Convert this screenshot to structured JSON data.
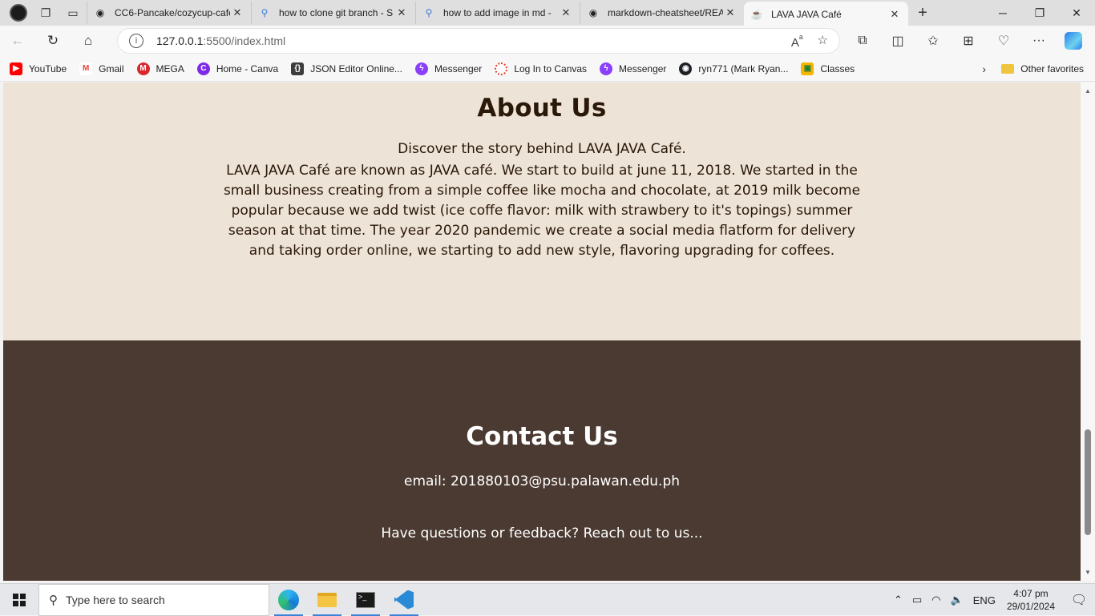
{
  "browser": {
    "tabs": [
      {
        "title": "CC6-Pancake/cozycup-cafe",
        "icon": "github-icon"
      },
      {
        "title": "how to clone git branch - S",
        "icon": "search-icon"
      },
      {
        "title": "how to add image in md -",
        "icon": "search-icon"
      },
      {
        "title": "markdown-cheatsheet/REA",
        "icon": "github-icon"
      },
      {
        "title": "LAVA JAVA Café",
        "icon": "coffee-icon",
        "active": true
      }
    ],
    "url_host": "127.0.0.1",
    "url_rest": ":5500/index.html",
    "favorites": [
      {
        "label": "YouTube",
        "icon": "youtube-icon",
        "color": "#ff0000"
      },
      {
        "label": "Gmail",
        "icon": "gmail-icon",
        "color": "#ea4335"
      },
      {
        "label": "MEGA",
        "icon": "mega-icon",
        "color": "#d9272e"
      },
      {
        "label": "Home - Canva",
        "icon": "canva-icon",
        "color": "#7d2ae8"
      },
      {
        "label": "JSON Editor Online...",
        "icon": "json-icon",
        "color": "#3c3c3c"
      },
      {
        "label": "Messenger",
        "icon": "messenger-icon",
        "color": "#8a3ffc"
      },
      {
        "label": "Log In to Canvas",
        "icon": "canvas-icon",
        "color": "#e13f2b"
      },
      {
        "label": "Messenger",
        "icon": "messenger-icon",
        "color": "#8a3ffc"
      },
      {
        "label": "ryn771 (Mark Ryan...",
        "icon": "github-icon",
        "color": "#1b1f23"
      },
      {
        "label": "Classes",
        "icon": "classroom-icon",
        "color": "#f4b400"
      }
    ],
    "other_favorites": "Other favorites"
  },
  "page": {
    "about": {
      "heading": "About Us",
      "intro": "Discover the story behind LAVA JAVA Café.",
      "story": "LAVA JAVA Café are known as JAVA café. We start to build at june 11, 2018. We started in the small business creating from a simple coffee like mocha and chocolate, at 2019 milk become popular because we add twist (ice coffe flavor: milk with strawbery to it's topings) summer season at that time. The year 2020 pandemic we create a social media flatform for delivery and taking order online, we starting to add new style, flavoring upgrading for coffees."
    },
    "contact": {
      "heading": "Contact Us",
      "email": "email: 201880103@psu.palawan.edu.ph",
      "reach": "Have questions or feedback? Reach out to us..."
    },
    "colors": {
      "about_bg": "#ede3d6",
      "contact_bg": "#4b3a31",
      "text_dark": "#2a1808"
    }
  },
  "taskbar": {
    "search_placeholder": "Type here to search",
    "language": "ENG",
    "time": "4:07 pm",
    "date": "29/01/2024"
  }
}
